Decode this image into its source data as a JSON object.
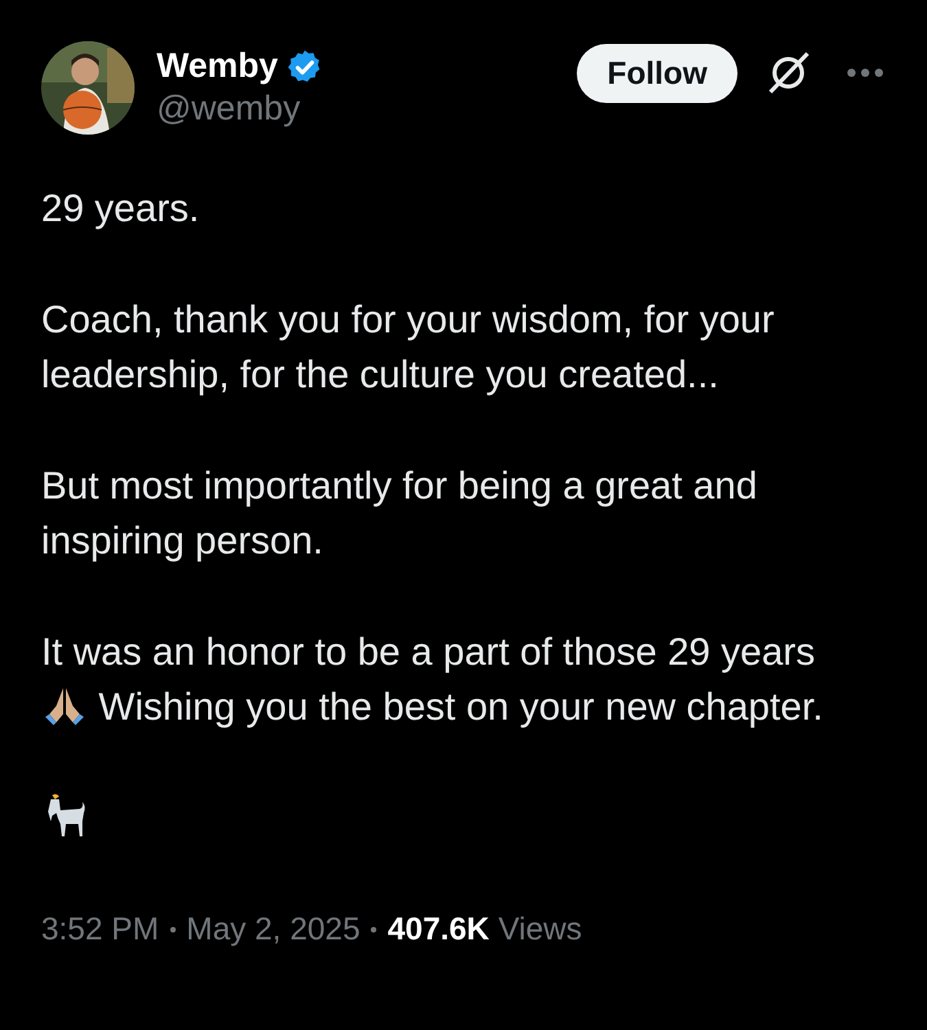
{
  "author": {
    "name": "Wemby",
    "handle": "@wemby",
    "verified": true
  },
  "follow_button": {
    "label": "Follow"
  },
  "paragraphs": [
    [
      {
        "kind": "text",
        "text": "29 years."
      }
    ],
    [
      {
        "kind": "text",
        "text": "Coach, thank you for your wisdom, for your leadership, for the culture you created..."
      }
    ],
    [
      {
        "kind": "text",
        "text": "But most importantly for being a great and inspiring person."
      }
    ],
    [
      {
        "kind": "text",
        "text": "It was an honor to be a part of those 29 years"
      },
      {
        "kind": "praying-hands"
      },
      {
        "kind": "text",
        "text": " Wishing you the best on your new chapter."
      }
    ],
    [
      {
        "kind": "goat"
      }
    ]
  ],
  "footer": {
    "time": "3:52 PM",
    "date": "May 2, 2025",
    "views_count": "407.6K",
    "views_label": "Views"
  }
}
